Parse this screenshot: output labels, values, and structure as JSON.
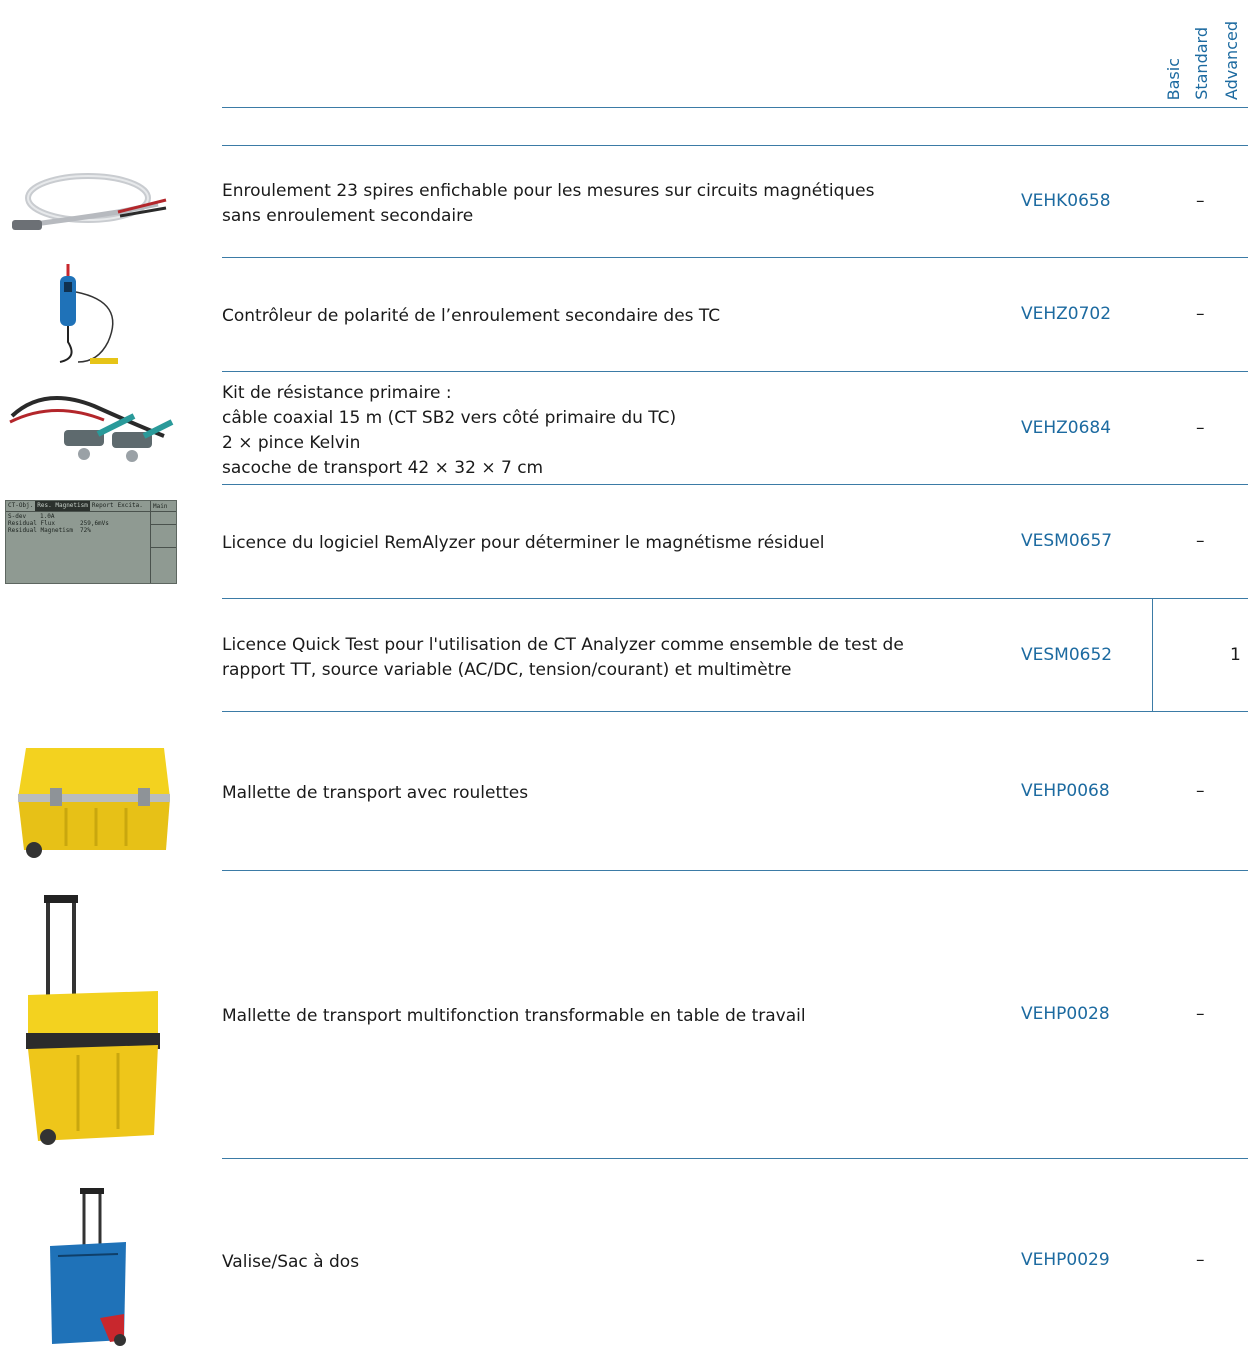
{
  "header": {
    "col_basic": "Basic",
    "col_standard": "Standard",
    "col_advanced": "Advanced"
  },
  "rows": [
    {
      "lines": [
        "Enroulement 23 spires enfichable pour les mesures sur circuits magnétiques",
        "sans enroulement secondaire"
      ],
      "code": "VEHK0658",
      "mark": "–"
    },
    {
      "lines": [
        "Contrôleur de polarité de l’enroulement secondaire des TC"
      ],
      "code": "VEHZ0702",
      "mark": "–"
    },
    {
      "lines": [
        "Kit de résistance primaire :",
        "câble coaxial 15 m (CT SB2 vers côté primaire du TC)",
        "2 × pince Kelvin",
        "sacoche de transport 42 × 32 × 7 cm"
      ],
      "code": "VEHZ0684",
      "mark": "–"
    },
    {
      "lines": [
        "Licence du logiciel RemAlyzer pour déterminer le magnétisme résiduel"
      ],
      "code": "VESM0657",
      "mark": "–"
    },
    {
      "lines": [
        "Licence Quick Test pour l'utilisation de CT Analyzer comme ensemble de test de",
        "rapport TT, source variable (AC/DC, tension/courant) et multimètre"
      ],
      "code": "VESM0652",
      "mark": "1"
    },
    {
      "lines": [
        "Mallette de transport avec roulettes"
      ],
      "code": "VEHP0068",
      "mark": "–"
    },
    {
      "lines": [
        "Mallette de transport multifonction transformable en table de travail"
      ],
      "code": "VEHP0028",
      "mark": "–"
    },
    {
      "lines": [
        "Valise/Sac à dos"
      ],
      "code": "VEHP0029",
      "mark": "–"
    }
  ],
  "screen": {
    "tabs": [
      "CT-Obj.",
      "Res. Magnetism",
      "Report",
      "Excita."
    ],
    "right_label": "Main",
    "rows": [
      [
        "S-dev",
        "1.0A"
      ],
      [
        "Residual Flux",
        "259,6mVs"
      ],
      [
        "Residual Magnetism",
        "72%"
      ]
    ]
  },
  "colors": {
    "accent": "#1c6aa0",
    "rule": "#3b7ba6",
    "case_yellow": "#f2cf1a",
    "bag_blue": "#1f72b8"
  }
}
